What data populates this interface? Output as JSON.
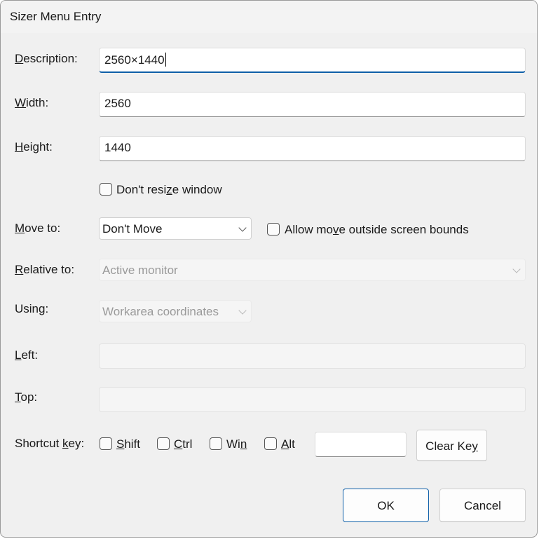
{
  "window": {
    "title": "Sizer Menu Entry"
  },
  "description": {
    "label_pre": "",
    "label_u": "D",
    "label_post": "escription:",
    "value": "2560×1440"
  },
  "width": {
    "label_pre": "",
    "label_u": "W",
    "label_post": "idth:",
    "value": "2560"
  },
  "height": {
    "label_pre": "",
    "label_u": "H",
    "label_post": "eight:",
    "value": "1440"
  },
  "dont_resize": {
    "pre": "Don't resi",
    "u": "z",
    "post": "e window",
    "checked": false
  },
  "move_to": {
    "label_pre": "",
    "label_u": "M",
    "label_post": "ove to:",
    "value": "Don't Move"
  },
  "allow_outside": {
    "pre": "Allow mo",
    "u": "v",
    "post": "e outside screen bounds",
    "checked": false
  },
  "relative_to": {
    "label_pre": "",
    "label_u": "R",
    "label_post": "elative to:",
    "value": "Active monitor"
  },
  "using": {
    "label": "Using:",
    "value": "Workarea coordinates"
  },
  "left": {
    "label_pre": "",
    "label_u": "L",
    "label_post": "eft:",
    "value": ""
  },
  "top": {
    "label_pre": "",
    "label_u": "T",
    "label_post": "op:",
    "value": ""
  },
  "shortcut": {
    "label_pre": "Shortcut ",
    "label_u": "k",
    "label_post": "ey:",
    "shift": {
      "pre": "",
      "u": "S",
      "post": "hift",
      "checked": false
    },
    "ctrl": {
      "pre": "",
      "u": "C",
      "post": "trl",
      "checked": false
    },
    "win": {
      "pre": "Wi",
      "u": "n",
      "post": "",
      "checked": false
    },
    "alt": {
      "pre": "",
      "u": "A",
      "post": "lt",
      "checked": false
    },
    "key_value": "",
    "clear": {
      "pre": "Clear Ke",
      "u": "y",
      "post": ""
    }
  },
  "buttons": {
    "ok": "OK",
    "cancel": "Cancel"
  },
  "colors": {
    "accent": "#0f5fa8",
    "background": "#f0f0f0"
  }
}
